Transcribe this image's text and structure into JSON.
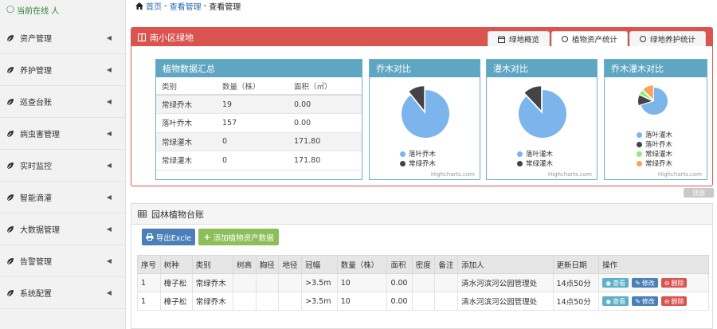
{
  "sidebar": {
    "online": "当前在线 人",
    "items": [
      {
        "label": "资产管理"
      },
      {
        "label": "养护管理"
      },
      {
        "label": "巡查台账"
      },
      {
        "label": "病虫害管理"
      },
      {
        "label": "实时监控"
      },
      {
        "label": "智能滴灌"
      },
      {
        "label": "大数据管理"
      },
      {
        "label": "告警管理"
      },
      {
        "label": "系统配置"
      }
    ]
  },
  "breadcrumb": {
    "home": "首页",
    "sep1": "-",
    "level1": "查看管理",
    "sep2": "-",
    "level2": "查看管理"
  },
  "panel1": {
    "title": "南小区绿地",
    "tabs": [
      {
        "label": "绿地概览"
      },
      {
        "label": "植物资产统计"
      },
      {
        "label": "绿地养护统计"
      }
    ]
  },
  "summary": {
    "title": "植物数据汇总",
    "headers": [
      "类别",
      "数量（株）",
      "面积（㎡）"
    ],
    "rows": [
      [
        "常绿乔木",
        "19",
        "0.00"
      ],
      [
        "落叶乔木",
        "157",
        "0.00"
      ],
      [
        "常绿灌木",
        "0",
        "171.80"
      ],
      [
        "常绿灌木",
        "0",
        "171.80"
      ]
    ]
  },
  "charts": {
    "credit": "Highcharts.com",
    "colors": {
      "light_blue": "#7cb5ec",
      "dark": "#434348",
      "green": "#90ed7d",
      "orange": "#f7a35c"
    }
  },
  "chart_data": [
    {
      "type": "pie",
      "title": "乔木对比",
      "labels": [
        "落叶乔木",
        "常绿乔木"
      ],
      "values": [
        157,
        19
      ]
    },
    {
      "type": "pie",
      "title": "灌木对比",
      "labels": [
        "落叶灌木",
        "常绿灌木"
      ],
      "values": [
        88,
        12
      ]
    },
    {
      "type": "pie",
      "title": "乔木灌木对比",
      "labels": [
        "落叶灌木",
        "落叶乔木",
        "常绿灌木",
        "常绿乔木"
      ],
      "values": [
        70,
        12,
        5,
        13
      ]
    }
  ],
  "topbtn": "顶部",
  "panel2": {
    "title": "园林植物台账",
    "export_label": "导出Excle",
    "add_label": "添加植物资产数据",
    "headers": [
      "序号",
      "树种",
      "类别",
      "树高",
      "胸径",
      "地径",
      "冠幅",
      "数量（株）",
      "面积",
      "密度",
      "备注",
      "添加人",
      "更新日期",
      "操作"
    ],
    "rows": [
      [
        "1",
        "樟子松",
        "常绿乔木",
        "",
        "",
        "",
        ">3.5m",
        "10",
        "0.00",
        "",
        "",
        "清水河滨河公园管理处",
        "14点50分"
      ],
      [
        "1",
        "樟子松",
        "常绿乔木",
        "",
        "",
        "",
        ">3.5m",
        "10",
        "0.00",
        "",
        "",
        "清水河滨河公园管理处",
        "14点50分"
      ]
    ],
    "actions": {
      "view": "查看",
      "edit": "修改",
      "delete": "删除"
    }
  }
}
